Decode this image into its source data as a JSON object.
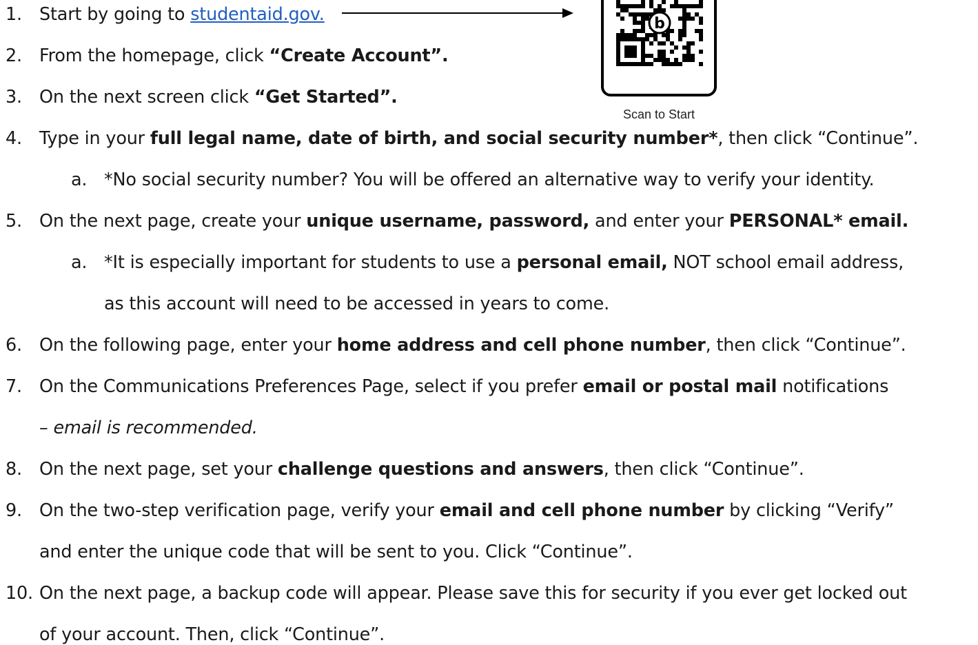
{
  "qr": {
    "caption": "Scan to Start"
  },
  "steps": [
    {
      "number": "1.",
      "parts": [
        {
          "text": "Start by going to ",
          "style": "normal"
        },
        {
          "text": "studentaid.gov.",
          "style": "link"
        }
      ]
    },
    {
      "number": "2.",
      "parts": [
        {
          "text": "From the homepage, click ",
          "style": "normal"
        },
        {
          "text": "“Create Account”.",
          "style": "bold"
        }
      ]
    },
    {
      "number": "3.",
      "parts": [
        {
          "text": "On the next screen click ",
          "style": "normal"
        },
        {
          "text": "“Get Started”.",
          "style": "bold"
        }
      ]
    },
    {
      "number": "4.",
      "parts": [
        {
          "text": "Type in your ",
          "style": "normal"
        },
        {
          "text": "full legal name, date of birth, and social security number*",
          "style": "bold"
        },
        {
          "text": ", then click “Continue”.",
          "style": "normal"
        }
      ]
    },
    {
      "number": "a.",
      "sub": true,
      "parts": [
        {
          "text": "*No social security number? You will be offered an alternative way to verify your identity.",
          "style": "normal"
        }
      ]
    },
    {
      "number": "5.",
      "parts": [
        {
          "text": "On the next page, create your ",
          "style": "normal"
        },
        {
          "text": "unique username, password,",
          "style": "bold"
        },
        {
          "text": " and enter your ",
          "style": "normal"
        },
        {
          "text": "PERSONAL* email.",
          "style": "bold"
        }
      ]
    },
    {
      "number": "a.",
      "sub": true,
      "parts": [
        {
          "text": "*It is especially important for students to use a ",
          "style": "normal"
        },
        {
          "text": "personal email,",
          "style": "bold"
        },
        {
          "text": " NOT school email address,",
          "style": "normal"
        }
      ]
    },
    {
      "number": "",
      "sub": true,
      "parts": [
        {
          "text": "as this account will need to be accessed in years to come.",
          "style": "normal"
        }
      ]
    },
    {
      "number": "6.",
      "parts": [
        {
          "text": "On the following page, enter your ",
          "style": "normal"
        },
        {
          "text": "home address and cell phone number",
          "style": "bold"
        },
        {
          "text": ", then click “Continue”.",
          "style": "normal"
        }
      ]
    },
    {
      "number": "7.",
      "parts": [
        {
          "text": "On the Communications Preferences Page, select if you prefer ",
          "style": "normal"
        },
        {
          "text": "email or postal mail",
          "style": "bold"
        },
        {
          "text": " notifications",
          "style": "normal"
        }
      ]
    },
    {
      "number": "",
      "parts": [
        {
          "text": "– ",
          "style": "normal"
        },
        {
          "text": "email is recommended.",
          "style": "italic"
        }
      ]
    },
    {
      "number": "8.",
      "parts": [
        {
          "text": "On the next page, set your ",
          "style": "normal"
        },
        {
          "text": "challenge questions and answers",
          "style": "bold"
        },
        {
          "text": ", then click “Continue”.",
          "style": "normal"
        }
      ]
    },
    {
      "number": "9.",
      "parts": [
        {
          "text": "On the two-step verification page, verify your ",
          "style": "normal"
        },
        {
          "text": "email and cell phone number",
          "style": "bold"
        },
        {
          "text": " by clicking “Verify”",
          "style": "normal"
        }
      ]
    },
    {
      "number": "",
      "parts": [
        {
          "text": "and enter the unique code that will be sent to you. Click “Continue”.",
          "style": "normal"
        }
      ]
    },
    {
      "number": "10.",
      "parts": [
        {
          "text": "On the next page, a backup code will appear. Please save this for security if you ever get locked out",
          "style": "normal"
        }
      ]
    },
    {
      "number": "",
      "parts": [
        {
          "text": "of your account. Then, click “Continue”.",
          "style": "normal"
        }
      ]
    }
  ]
}
